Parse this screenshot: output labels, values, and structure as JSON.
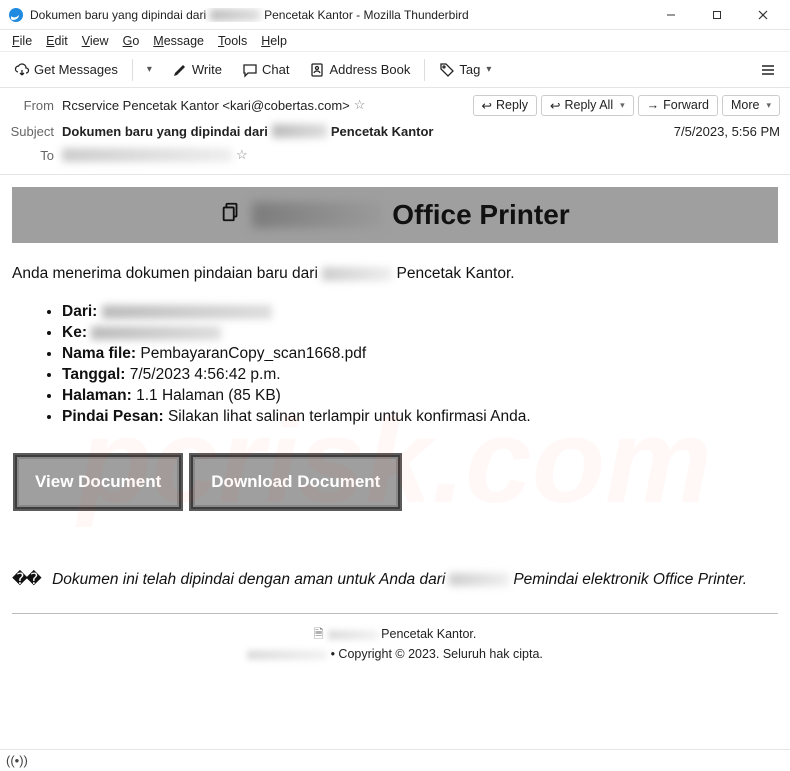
{
  "window": {
    "title_pre": "Dokumen baru yang dipindai dari",
    "title_post": "Pencetak Kantor - Mozilla Thunderbird"
  },
  "menu": {
    "file": "File",
    "edit": "Edit",
    "view": "View",
    "go": "Go",
    "message": "Message",
    "tools": "Tools",
    "help": "Help"
  },
  "toolbar": {
    "get_messages": "Get Messages",
    "write": "Write",
    "chat": "Chat",
    "address_book": "Address Book",
    "tag": "Tag"
  },
  "headers": {
    "from_label": "From",
    "from_value": "Rcservice Pencetak Kantor <kari@cobertas.com>",
    "subject_label": "Subject",
    "subject_pre": "Dokumen baru yang dipindai dari",
    "subject_post": "Pencetak Kantor",
    "to_label": "To",
    "date": "7/5/2023, 5:56 PM",
    "reply": "Reply",
    "reply_all": "Reply All",
    "forward": "Forward",
    "more": "More"
  },
  "body": {
    "banner_title_post": "Office Printer",
    "intro_pre": "Anda menerima dokumen pindaian baru dari",
    "intro_post": "Pencetak Kantor.",
    "labels": {
      "dari": "Dari:",
      "ke": "Ke:",
      "nama_file": "Nama file:",
      "nama_file_val": "PembayaranCopy_scan1668.pdf",
      "tanggal": "Tanggal:",
      "tanggal_val": "7/5/2023 4:56:42 p.m.",
      "halaman": "Halaman:",
      "halaman_val": "1.1 Halaman (85 KB)",
      "pesan": "Pindai Pesan:",
      "pesan_val": "Silakan lihat salinan terlampir untuk konfirmasi Anda."
    },
    "view_btn": "View Document",
    "download_btn": "Download Document",
    "footer_italic_pre": "Dokumen ini telah dipindai dengan aman untuk Anda dari",
    "footer_italic_post": "Pemindai elektronik Office Printer.",
    "copy_line1": "Pencetak Kantor.",
    "copy_line2": "• Copyright © 2023. Seluruh hak cipta."
  }
}
